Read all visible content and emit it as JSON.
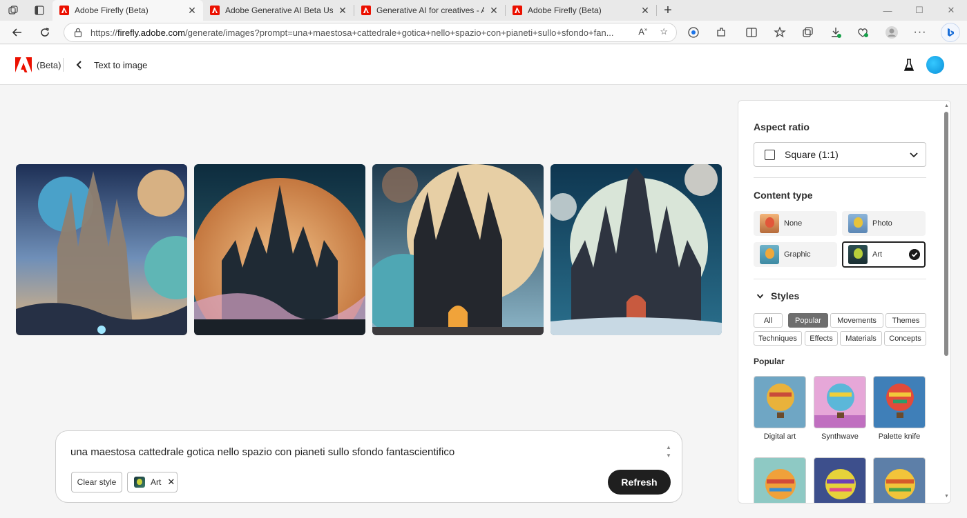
{
  "browser": {
    "tabs": [
      {
        "label": "Adobe Firefly (Beta)",
        "active": true
      },
      {
        "label": "Adobe Generative AI Beta User G",
        "active": false
      },
      {
        "label": "Generative AI for creatives - Ado",
        "active": false
      },
      {
        "label": "Adobe Firefly (Beta)",
        "active": false
      }
    ],
    "url_scheme": "https://",
    "url_host": "firefly.adobe.com",
    "url_path": "/generate/images?prompt=una+maestosa+cattedrale+gotica+nello+spazio+con+pianeti+sullo+sfondo+fan..."
  },
  "header": {
    "beta_label": "(Beta)",
    "page_title": "Text to image"
  },
  "images": [
    {
      "alt": "generated-image-1"
    },
    {
      "alt": "generated-image-2"
    },
    {
      "alt": "generated-image-3"
    },
    {
      "alt": "generated-image-4"
    }
  ],
  "prompt": {
    "text": "una maestosa cattedrale gotica nello spazio con pianeti sullo sfondo fantascientifico",
    "clear_style": "Clear style",
    "chip_label": "Art",
    "refresh": "Refresh"
  },
  "panel": {
    "aspect_ratio_label": "Aspect ratio",
    "aspect_ratio_value": "Square (1:1)",
    "content_type_label": "Content type",
    "content_types": [
      {
        "label": "None",
        "selected": false
      },
      {
        "label": "Photo",
        "selected": false
      },
      {
        "label": "Graphic",
        "selected": false
      },
      {
        "label": "Art",
        "selected": true
      }
    ],
    "styles_label": "Styles",
    "style_filters": [
      "All",
      "Popular",
      "Movements",
      "Themes",
      "Techniques",
      "Effects",
      "Materials",
      "Concepts"
    ],
    "active_filter": "Popular",
    "popular_label": "Popular",
    "popular_items": [
      {
        "label": "Digital art"
      },
      {
        "label": "Synthwave"
      },
      {
        "label": "Palette knife"
      },
      {
        "label": ""
      },
      {
        "label": ""
      },
      {
        "label": ""
      }
    ]
  },
  "colors": {
    "accent": "#1f1f1f",
    "adobe_red": "#eb1000",
    "avatar": "#1aa7ec"
  }
}
